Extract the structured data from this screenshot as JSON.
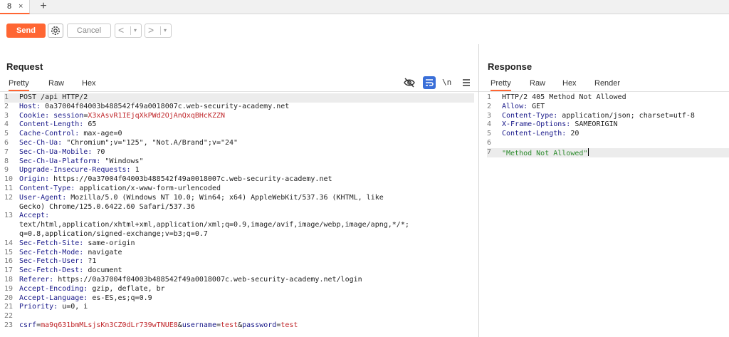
{
  "tabs": [
    {
      "label": "8",
      "close": "×"
    }
  ],
  "new_tab": "+",
  "toolbar": {
    "send_label": "Send",
    "cancel_label": "Cancel",
    "back_arrow": "<",
    "forward_arrow": ">",
    "dropdown": "▾"
  },
  "request": {
    "title": "Request",
    "tabs": [
      "Pretty",
      "Raw",
      "Hex"
    ],
    "active_tab": "Pretty",
    "newline_toggle": "\\n",
    "lines": [
      {
        "n": "1",
        "text": "POST /api HTTP/2"
      },
      {
        "n": "2",
        "name": "Host:",
        "value": " 0a37004f04003b488542f49a0018007c.web-security-academy.net"
      },
      {
        "n": "3",
        "name": "Cookie:",
        "cookie_name": " session",
        "cookie_value": "X3xAsvR1IEjqXkPWd2OjAnQxqBHcKZZN"
      },
      {
        "n": "4",
        "name": "Content-Length:",
        "value": " 65"
      },
      {
        "n": "5",
        "name": "Cache-Control:",
        "value": " max-age=0"
      },
      {
        "n": "6",
        "name": "Sec-Ch-Ua:",
        "value": " \"Chromium\";v=\"125\", \"Not.A/Brand\";v=\"24\""
      },
      {
        "n": "7",
        "name": "Sec-Ch-Ua-Mobile:",
        "value": " ?0"
      },
      {
        "n": "8",
        "name": "Sec-Ch-Ua-Platform:",
        "value": " \"Windows\""
      },
      {
        "n": "9",
        "name": "Upgrade-Insecure-Requests:",
        "value": " 1"
      },
      {
        "n": "10",
        "name": "Origin:",
        "value": " https://0a37004f04003b488542f49a0018007c.web-security-academy.net"
      },
      {
        "n": "11",
        "name": "Content-Type:",
        "value": " application/x-www-form-urlencoded"
      },
      {
        "n": "12",
        "name": "User-Agent:",
        "value": " Mozilla/5.0 (Windows NT 10.0; Win64; x64) AppleWebKit/537.36 (KHTML, like",
        "cont": "Gecko) Chrome/125.0.6422.60 Safari/537.36"
      },
      {
        "n": "13",
        "name": "Accept:",
        "value": "",
        "cont": "text/html,application/xhtml+xml,application/xml;q=0.9,image/avif,image/webp,image/apng,*/*;",
        "cont2": "q=0.8,application/signed-exchange;v=b3;q=0.7"
      },
      {
        "n": "14",
        "name": "Sec-Fetch-Site:",
        "value": " same-origin"
      },
      {
        "n": "15",
        "name": "Sec-Fetch-Mode:",
        "value": " navigate"
      },
      {
        "n": "16",
        "name": "Sec-Fetch-User:",
        "value": " ?1"
      },
      {
        "n": "17",
        "name": "Sec-Fetch-Dest:",
        "value": " document"
      },
      {
        "n": "18",
        "name": "Referer:",
        "value": " https://0a37004f04003b488542f49a0018007c.web-security-academy.net/login"
      },
      {
        "n": "19",
        "name": "Accept-Encoding:",
        "value": " gzip, deflate, br"
      },
      {
        "n": "20",
        "name": "Accept-Language:",
        "value": " es-ES,es;q=0.9"
      },
      {
        "n": "21",
        "name": "Priority:",
        "value": " u=0, i"
      },
      {
        "n": "22",
        "text": ""
      },
      {
        "n": "23",
        "body": [
          {
            "k": "csrf",
            "v": "ma9q631bmMLsjsKn3CZ0dLr739wTNUE8"
          },
          {
            "k": "username",
            "v": "test"
          },
          {
            "k": "password",
            "v": "test"
          }
        ]
      }
    ]
  },
  "response": {
    "title": "Response",
    "tabs": [
      "Pretty",
      "Raw",
      "Hex",
      "Render"
    ],
    "active_tab": "Pretty",
    "lines": [
      {
        "n": "1",
        "text": "HTTP/2 405 Method Not Allowed"
      },
      {
        "n": "2",
        "name": "Allow:",
        "value": " GET"
      },
      {
        "n": "3",
        "name": "Content-Type:",
        "value": " application/json; charset=utf-8"
      },
      {
        "n": "4",
        "name": "X-Frame-Options:",
        "value": " SAMEORIGIN"
      },
      {
        "n": "5",
        "name": "Content-Length:",
        "value": " 20"
      },
      {
        "n": "6",
        "text": ""
      },
      {
        "n": "7",
        "json": "\"Method Not Allowed\""
      }
    ]
  },
  "colors": {
    "accent": "#ff6633",
    "header_name": "#1a1a8a",
    "param_value": "#c0282c",
    "json_string": "#2b8a2b",
    "active_icon": "#3a6fd8"
  }
}
